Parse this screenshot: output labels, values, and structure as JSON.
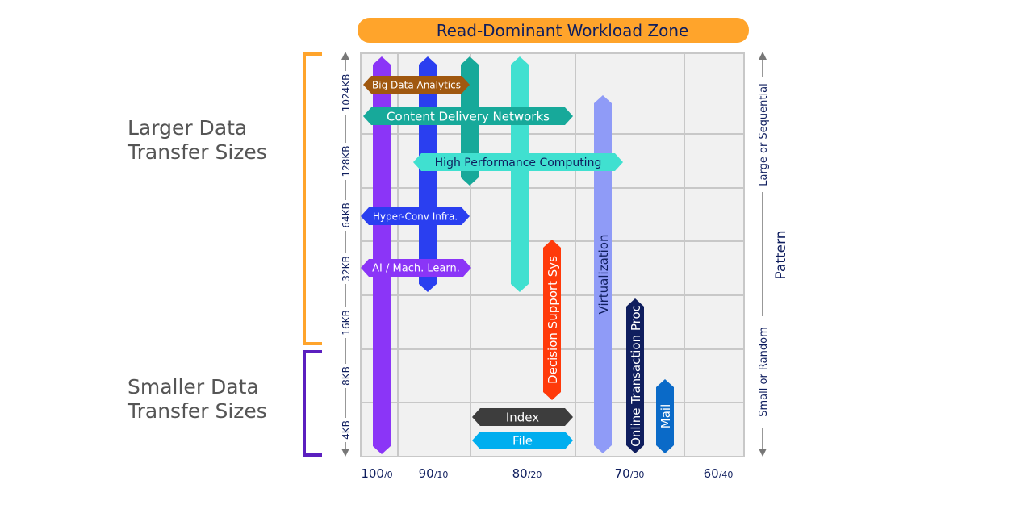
{
  "banner": {
    "label": "Read-Dominant Workload Zone",
    "color": "#ffa42b"
  },
  "left_groups": [
    {
      "label_line1": "Larger Data",
      "label_line2": "Transfer Sizes",
      "bracket_color": "#ffa42b"
    },
    {
      "label_line1": "Smaller Data",
      "label_line2": "Transfer Sizes",
      "bracket_color": "#5b1fbf"
    }
  ],
  "y_axis": {
    "ticks": [
      "1024KB",
      "128KB",
      "64KB",
      "32KB",
      "16KB",
      "8KB",
      "4KB"
    ]
  },
  "x_axis": {
    "ticks": [
      {
        "main": "100",
        "sub": "/0"
      },
      {
        "main": "90",
        "sub": "/10"
      },
      {
        "main": "80",
        "sub": "/20"
      },
      {
        "main": "70",
        "sub": "/30"
      },
      {
        "main": "60",
        "sub": "/40"
      }
    ]
  },
  "right_axis": {
    "top_label": "Large or Sequential",
    "bottom_label": "Small or Random",
    "title": "Pattern"
  },
  "workloads_vertical": [
    {
      "label": "",
      "color": "#8b35f7"
    },
    {
      "label": "",
      "color": "#2a3ff0"
    },
    {
      "label": "",
      "color": "#17a99a"
    },
    {
      "label": "",
      "color": "#40e0d0"
    },
    {
      "label": "Decision Support Sys",
      "color": "#ff3a0a",
      "text_color": "#ffffff"
    },
    {
      "label": "Virtualization",
      "color": "#8f9bf7",
      "text_color": "#0f1e5e"
    },
    {
      "label": "Online Transaction Proc",
      "color": "#0f1e5e",
      "text_color": "#ffffff"
    },
    {
      "label": "Mail",
      "color": "#0a6ac8",
      "text_color": "#ffffff"
    }
  ],
  "workloads_horizontal": [
    {
      "label": "Big Data Analytics",
      "color": "#a0580f",
      "text_color": "#ffffff"
    },
    {
      "label": "Content Delivery Networks",
      "color": "#17a99a",
      "text_color": "#ffffff"
    },
    {
      "label": "High Performance Computing",
      "color": "#40e0d0",
      "text_color": "#0f1e5e"
    },
    {
      "label": "Hyper-Conv Infra.",
      "color": "#2a3ff0",
      "text_color": "#ffffff"
    },
    {
      "label": "AI / Mach. Learn.",
      "color": "#8b35f7",
      "text_color": "#ffffff"
    },
    {
      "label": "Index",
      "color": "#3d3d3d",
      "text_color": "#ffffff"
    },
    {
      "label": "File",
      "color": "#00aeef",
      "text_color": "#ffffff"
    }
  ]
}
